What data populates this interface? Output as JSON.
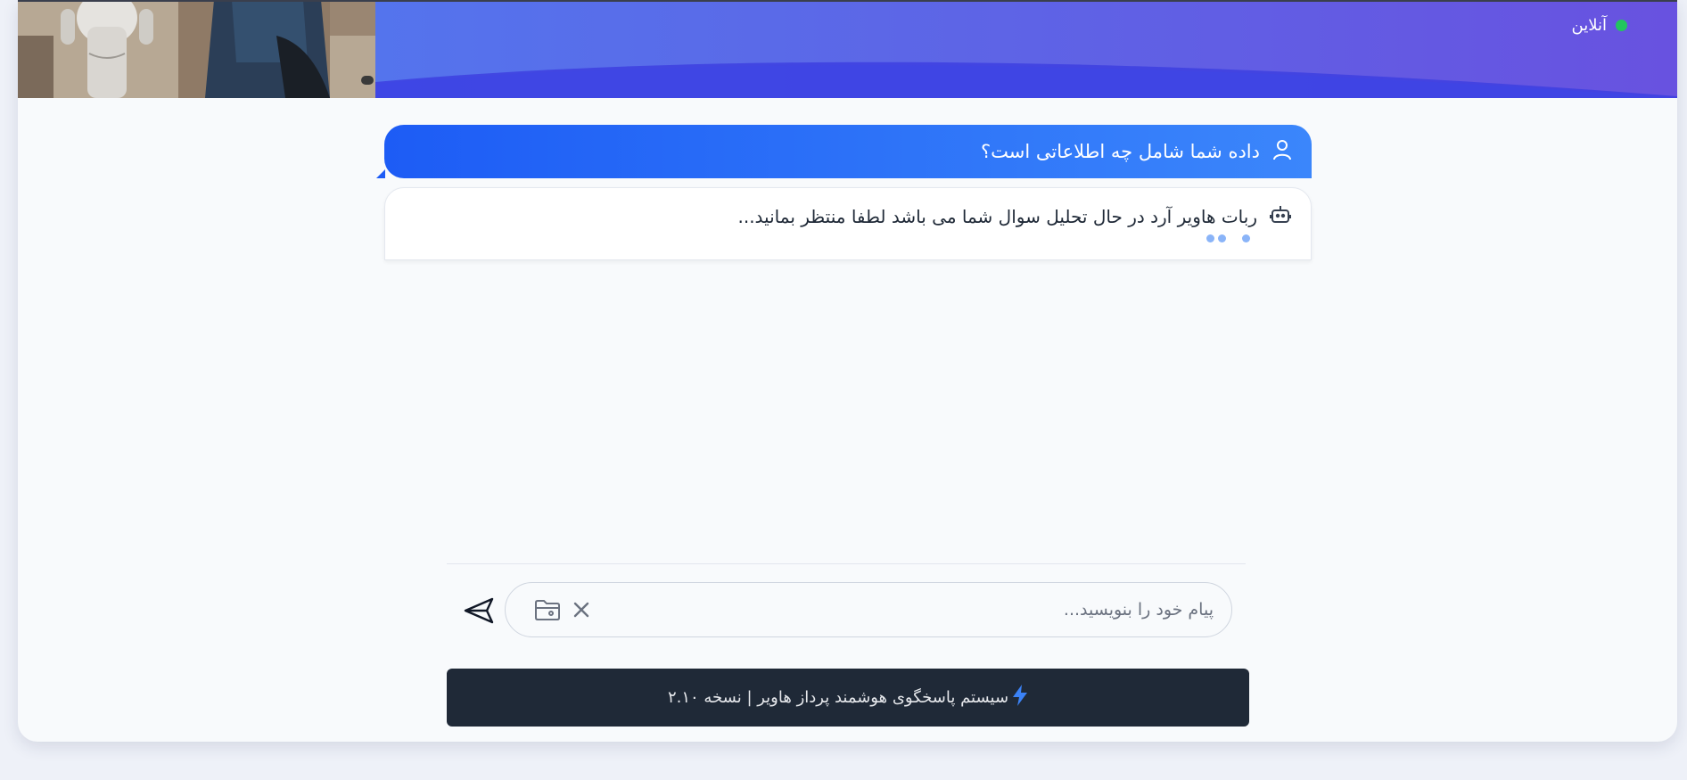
{
  "header": {
    "status_label": "آنلاین",
    "status_color": "#22c55e",
    "photo_badge": "ai"
  },
  "chat": {
    "messages": [
      {
        "role": "user",
        "icon": "user-icon",
        "text": "داده شما شامل چه اطلاعاتی است؟"
      },
      {
        "role": "bot",
        "icon": "robot-icon",
        "text": "ربات هاویر آرد در حال تحلیل سوال شما می باشد لطفا منتظر بمانید..."
      }
    ]
  },
  "composer": {
    "placeholder": "پیام خود را بنویسید...",
    "send_icon": "send-icon",
    "attach_icon": "folder-icon",
    "clear_icon": "close-icon"
  },
  "footer": {
    "icon": "lightning-icon",
    "text": "سیستم پاسخگوی هوشمند پرداز هاویر | نسخه ۲.۱۰"
  },
  "colors": {
    "accent": "#1d5cf5",
    "header_gradient_start": "#4f7df2",
    "header_gradient_end": "#6852e0",
    "footer_bg": "#1f2937"
  }
}
